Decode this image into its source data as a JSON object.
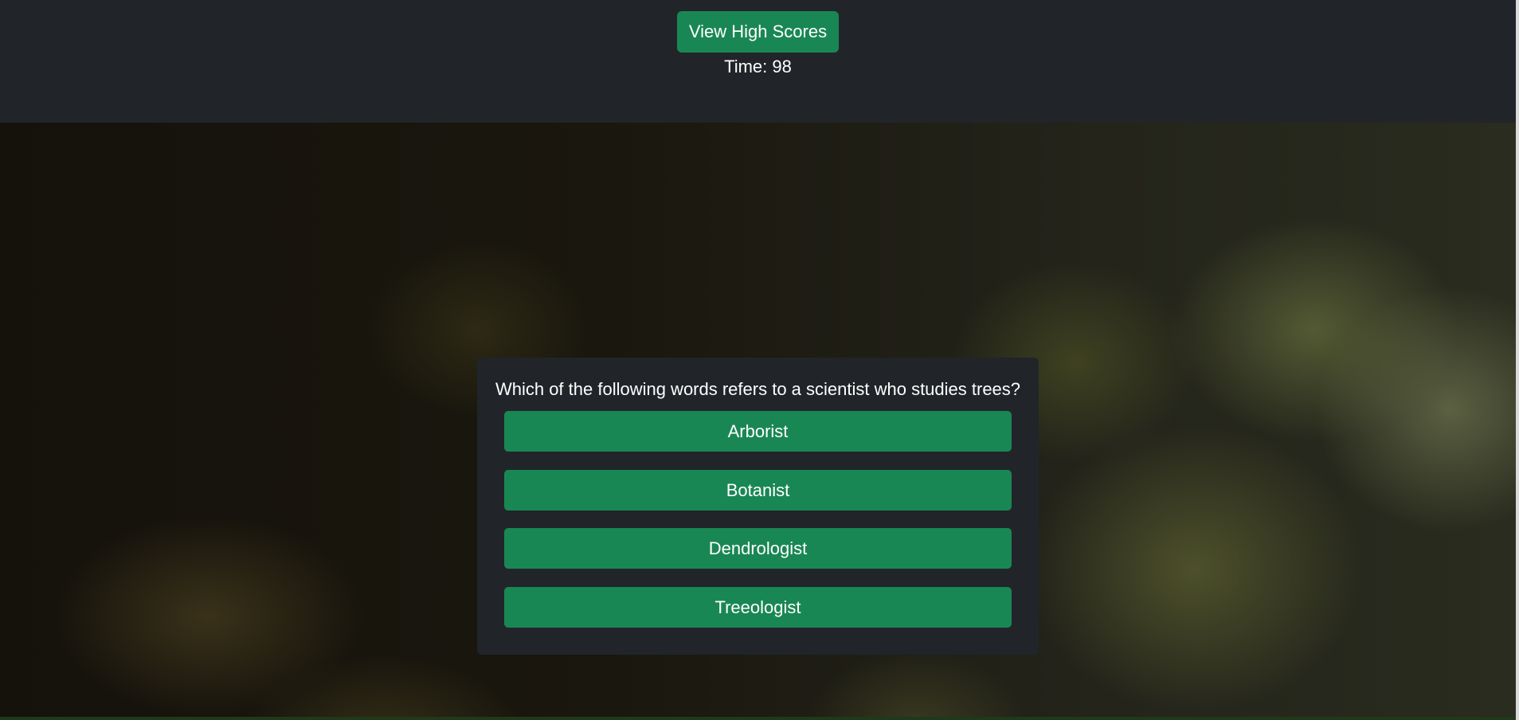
{
  "header": {
    "high_scores_label": "View High Scores",
    "timer_label": "Time:",
    "timer_value": "98"
  },
  "quiz": {
    "question": "Which of the following words refers to a scientist who studies trees?",
    "answers": [
      {
        "label": "Arborist"
      },
      {
        "label": "Botanist"
      },
      {
        "label": "Dendrologist"
      },
      {
        "label": "Treeologist"
      }
    ]
  },
  "colors": {
    "header_bg": "#212529",
    "button_green": "#198754",
    "card_bg": "#212529",
    "text": "#ffffff"
  }
}
